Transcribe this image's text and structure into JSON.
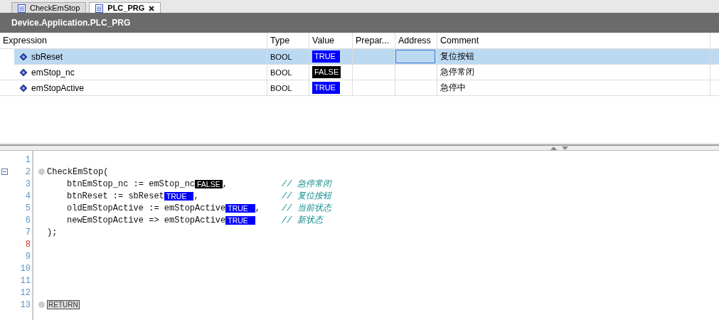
{
  "tabs": [
    {
      "label": "CheckEmStop",
      "selected": false,
      "closable": false
    },
    {
      "label": "PLC_PRG",
      "selected": true,
      "closable": true
    }
  ],
  "title": "Device.Application.PLC_PRG",
  "watch": {
    "columns": [
      "Expression",
      "Type",
      "Value",
      "Prepar...",
      "Address",
      "Comment"
    ],
    "rows": [
      {
        "expression": "sbReset",
        "type": "BOOL",
        "value": {
          "text": "TRUE",
          "on": true
        },
        "comment": "复位按钮",
        "selected": true
      },
      {
        "expression": "emStop_nc",
        "type": "BOOL",
        "value": {
          "text": "FALSE",
          "on": false
        },
        "comment": "急停常闭",
        "selected": false
      },
      {
        "expression": "emStopActive",
        "type": "BOOL",
        "value": {
          "text": "TRUE",
          "on": true
        },
        "comment": "急停中",
        "selected": false
      }
    ]
  },
  "code_lines": [
    {
      "number": "1",
      "current": false,
      "breakpoint": false
    },
    {
      "number": "2",
      "current": false,
      "breakpoint": true,
      "tokens": [
        {
          "kind": "code",
          "text": "CheckEmStop("
        }
      ],
      "children": [
        {
          "number": "3",
          "current": false,
          "breakpoint": false,
          "tokens": [
            {
              "kind": "code",
              "text": "btnEmStop_nc := emStop_nc"
            },
            {
              "kind": "value",
              "text": "FALSE",
              "on": false
            },
            {
              "kind": "code",
              "text": ","
            }
          ],
          "comment": "// 急停常闭"
        },
        {
          "number": "4",
          "current": false,
          "breakpoint": false,
          "tokens": [
            {
              "kind": "code",
              "text": "btnReset := sbReset"
            },
            {
              "kind": "value",
              "text": "TRUE",
              "on": true
            },
            {
              "kind": "code",
              "text": ","
            }
          ],
          "comment": "// 复位按钮"
        },
        {
          "number": "5",
          "current": false,
          "breakpoint": false,
          "tokens": [
            {
              "kind": "code",
              "text": "oldEmStopActive := emStopActive"
            },
            {
              "kind": "value",
              "text": "TRUE",
              "on": true
            },
            {
              "kind": "code",
              "text": ","
            }
          ],
          "comment": "// 当前状态"
        },
        {
          "number": "6",
          "current": false,
          "breakpoint": false,
          "tokens": [
            {
              "kind": "code",
              "text": "newEmStopActive => emStopActive"
            },
            {
              "kind": "value",
              "text": "TRUE",
              "on": true
            }
          ],
          "comment": "// 新状态"
        }
      ]
    },
    {
      "number": "7",
      "current": false,
      "breakpoint": false,
      "tokens": [
        {
          "kind": "code",
          "text": ");"
        }
      ]
    },
    {
      "number": "8",
      "current": true,
      "breakpoint": false
    },
    {
      "number": "9",
      "current": false,
      "breakpoint": false
    },
    {
      "number": "10",
      "current": false,
      "breakpoint": false
    },
    {
      "number": "11",
      "current": false,
      "breakpoint": false
    },
    {
      "number": "12",
      "current": false,
      "breakpoint": false
    },
    {
      "number": "13",
      "current": false,
      "breakpoint": true,
      "tokens": [
        {
          "kind": "keyword",
          "text": "RETURN"
        }
      ]
    }
  ]
}
